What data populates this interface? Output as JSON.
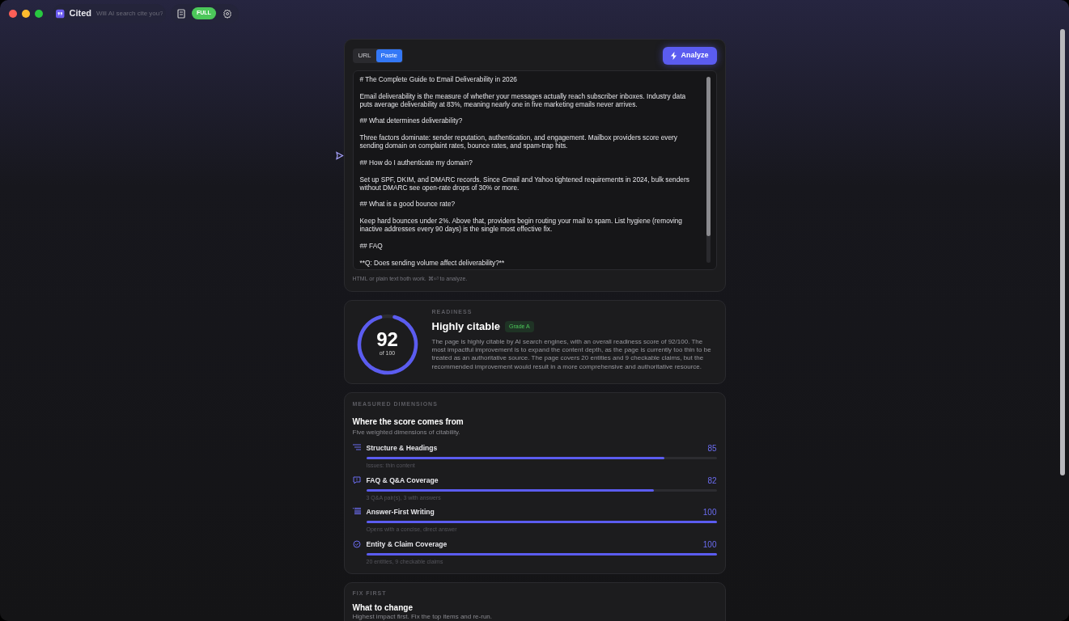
{
  "titlebar": {
    "app_name": "Cited",
    "search": {
      "placeholder": "Will AI search cite you?"
    },
    "plan_badge": "FULL"
  },
  "input_card": {
    "tabs": [
      {
        "label": "URL",
        "selected": false
      },
      {
        "label": "Paste",
        "selected": true
      }
    ],
    "analyze_button": "Analyze",
    "content": "# The Complete Guide to Email Deliverability in 2026\n\nEmail deliverability is the measure of whether your messages actually reach subscriber inboxes. Industry data puts average deliverability at 83%, meaning nearly one in five marketing emails never arrives.\n\n## What determines deliverability?\n\nThree factors dominate: sender reputation, authentication, and engagement. Mailbox providers score every sending domain on complaint rates, bounce rates, and spam-trap hits.\n\n## How do I authenticate my domain?\n\nSet up SPF, DKIM, and DMARC records. Since Gmail and Yahoo tightened requirements in 2024, bulk senders without DMARC see open-rate drops of 30% or more.\n\n## What is a good bounce rate?\n\nKeep hard bounces under 2%. Above that, providers begin routing your mail to spam. List hygiene (removing inactive addresses every 90 days) is the single most effective fix.\n\n## FAQ\n\n**Q: Does sending volume affect deliverability?**",
    "hint": "HTML or plain text both work. ⌘⏎ to analyze."
  },
  "readiness": {
    "eyebrow": "READINESS",
    "score": "92",
    "score_of": "of 100",
    "title": "Highly citable",
    "grade": "Grade A",
    "summary": "The page is highly citable by AI search engines, with an overall readiness score of 92/100. The most impactful improvement is to expand the content depth, as the page is currently too thin to be treated as an authoritative source. The page covers 20 entities and 9 checkable claims, but the recommended improvement would result in a more comprehensive and authoritative resource."
  },
  "dimensions": {
    "eyebrow": "MEASURED DIMENSIONS",
    "title": "Where the score comes from",
    "subtitle": "Five weighted dimensions of citability.",
    "items": [
      {
        "kind": "list",
        "name": "Structure & Headings",
        "score": "85",
        "level": 0.85,
        "note": "Issues: thin content"
      },
      {
        "kind": "chat",
        "name": "FAQ & Q&A Coverage",
        "score": "82",
        "level": 0.82,
        "note": "3 Q&A pair(s), 3 with answers"
      },
      {
        "kind": "lines",
        "name": "Answer-First Writing",
        "score": "100",
        "level": 1,
        "note": "Opens with a concise, direct answer"
      },
      {
        "kind": "check",
        "name": "Entity & Claim Coverage",
        "score": "100",
        "level": 1,
        "note": "20 entities, 9 checkable claims"
      }
    ]
  },
  "fix_first": {
    "eyebrow": "FIX FIRST",
    "title": "What to change",
    "subtitle": "Highest impact first. Fix the top items and re-run."
  }
}
